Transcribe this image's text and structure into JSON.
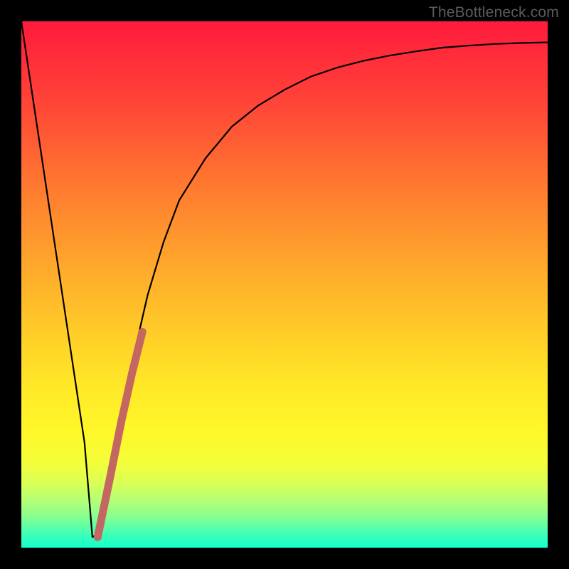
{
  "watermark": {
    "text": "TheBottleneck.com"
  },
  "palette": {
    "curve": "#000000",
    "trend": "#c46662",
    "background": "#000000"
  },
  "chart_data": {
    "type": "line",
    "title": "",
    "xlabel": "",
    "ylabel": "",
    "xlim": [
      0,
      100
    ],
    "ylim": [
      0,
      100
    ],
    "series": [
      {
        "name": "bottleneck-curve",
        "x": [
          0,
          3,
          6,
          9,
          12,
          13.5,
          15,
          18,
          21,
          24,
          27,
          30,
          35,
          40,
          45,
          50,
          55,
          60,
          65,
          70,
          75,
          80,
          85,
          90,
          95,
          100
        ],
        "values": [
          100,
          80,
          60,
          40,
          20,
          2,
          3,
          20,
          35,
          48,
          58,
          66,
          74,
          80,
          84,
          87,
          89.5,
          91.2,
          92.5,
          93.5,
          94.3,
          95,
          95.4,
          95.7,
          95.9,
          96
        ]
      },
      {
        "name": "trend-segment",
        "x": [
          14.5,
          17,
          19,
          21,
          23
        ],
        "values": [
          2,
          14,
          24,
          33,
          41
        ]
      }
    ]
  }
}
